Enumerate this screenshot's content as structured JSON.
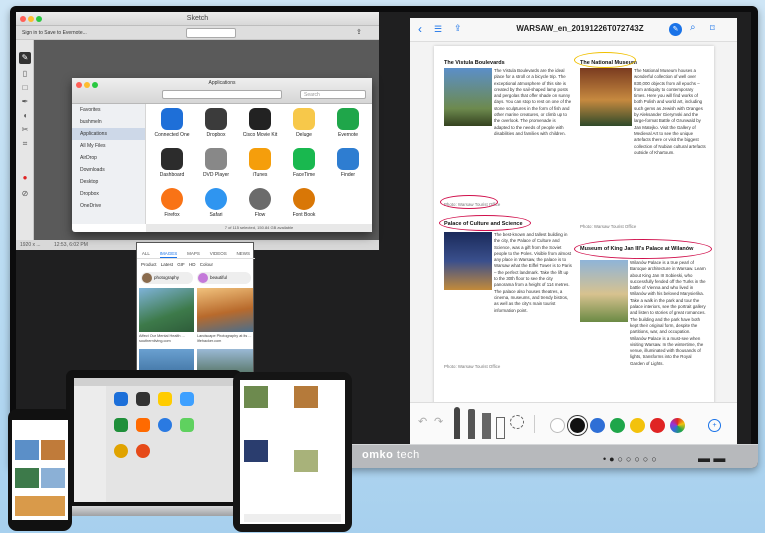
{
  "sketch": {
    "title": "Sketch",
    "toolbar_left": "Sign in to Save to Evernote...",
    "status_left": "1920 x ...",
    "status_time": "12:53, 6:02 PM",
    "finder": {
      "title": "Applications",
      "search_placeholder": "Search",
      "sidebar": [
        "Favorites",
        "bushmeln",
        "Applications",
        "All My Files",
        "AirDrop",
        "Downloads",
        "Desktop",
        "Dropbox",
        "OneDrive"
      ],
      "apps": [
        "Connected One",
        "Dropbox",
        "Cisco Movie Kit",
        "Deluge",
        "Evernote",
        "Dashboard",
        "DVD Player",
        "iTunes",
        "FaceTime",
        "Finder",
        "Firefox",
        "Safari",
        "Flow",
        "Font Book"
      ],
      "footer": "7 of 115 selected, 150.84 GB available"
    }
  },
  "browser": {
    "tabs": [
      "ALL",
      "IMAGES",
      "MAPS",
      "VIDEOS",
      "NEWS"
    ],
    "active_tab": "IMAGES",
    "filters": "Product   Latest   GIF   HD   Colour",
    "chips": [
      "photography",
      "beautiful"
    ],
    "captions": [
      "Affect Our Mental Health ... southernliving.com",
      "Landscape Photography at its ... lifehacker.com"
    ]
  },
  "document": {
    "title": "WARSAW_en_20191226T072743Z",
    "sections": [
      {
        "heading": "The Vistula Boulevards",
        "body": "The Vistula Boulevards are the ideal place for a stroll or a bicycle trip. The exceptional atmosphere of this site is created by the sail-shaped lamp posts and pergolas that offer shade on sunny days. You can stop to rest on one of the stone sculptures in the form of fish and other marine creatures, or climb up to the overlook. The promenade is adapted to the needs of people with disabilities and families with children.",
        "photo": "Photo: Warsaw Tourist Office"
      },
      {
        "heading": "Palace of Culture and Science",
        "body": "The best-known and tallest building in the city, the Palace of Culture and Science, was a gift from the Soviet people to the Poles. Visible from almost any place in Warsaw, the palace is to Warsaw what the Eiffel Tower is to Paris – the perfect landmark. Take the lift up to the 30th floor to see the city panorama from a height of 114 metres. The palace also houses theatres, a cinema, museums, and trendy bistros, as well as the city's main tourist information point.",
        "photo": "Photo: Warsaw Tourist Office"
      },
      {
        "heading": "The National Museum",
        "body": "The National Museum houses a wonderful collection of well over 830,000 objects from all epochs – from antiquity to contemporary times. Here you will find works of both Polish and world art, including such gems as Jewish with Oranges by Aleksander Gierymski and the large-format Battle of Grunwald by Jan Matejko. Visit the Gallery of Medieval Art to see the unique artefacts there or visit the biggest collection of Nubian cultural artefacts outside of Khartoum.",
        "photo": "Photo: Warsaw Tourist Office"
      },
      {
        "heading": "Museum of King Jan III's Palace at Wilanów",
        "body": "Wilanów Palace is a true pearl of Baroque architecture in Warsaw. Learn about King Jan III Sobieski, who successfully fended off the Turks in the battle of Vienna and who lived in Wilanów with his beloved Marysieńka. Take a walk in the park and tour the palace interiors, see the portrait gallery and listen to stories of great romances. The building and the park have both kept their original form, despite the partitions, war, and occupation. Wilanów Palace is a must-see when visiting Warsaw. In the wintertime, the venue, illuminated with thousands of lights, transforms into the Royal Garden of Lights.",
        "photo": "Photo: Warsaw Tourist Office"
      }
    ],
    "palette": [
      "#ffffff",
      "#111111",
      "#2f6fd6",
      "#1fa64a",
      "#f3c20c",
      "#e02424"
    ]
  },
  "bezel": {
    "brand": "omko",
    "brand_suffix": "tech"
  }
}
